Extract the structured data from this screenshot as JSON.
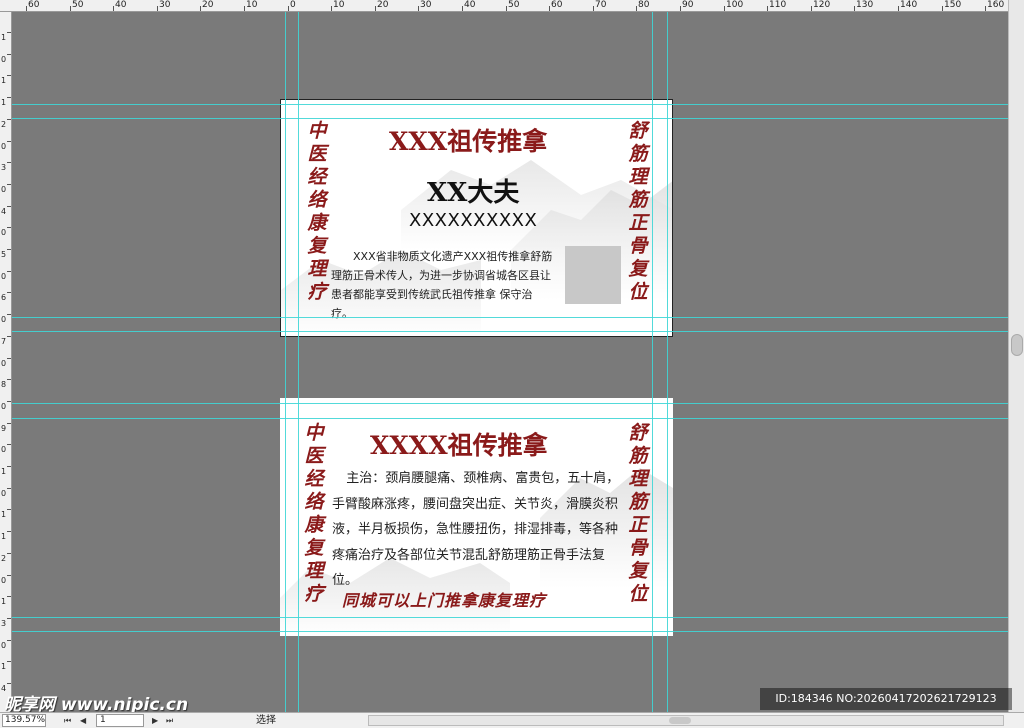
{
  "ruler": {
    "top_labels": [
      "60",
      "50",
      "40",
      "30",
      "20",
      "10",
      "0",
      "10",
      "20",
      "30",
      "40",
      "50",
      "60",
      "70",
      "80",
      "90",
      "100",
      "110",
      "120",
      "130",
      "140",
      "150",
      "160"
    ],
    "left_labels": [
      "1",
      "0",
      "1",
      "1",
      "2",
      "0",
      "3",
      "0",
      "4",
      "0",
      "5",
      "0",
      "6",
      "0",
      "7",
      "0",
      "8",
      "0",
      "9",
      "0",
      "1",
      "0",
      "1",
      "1",
      "2",
      "0",
      "1",
      "3",
      "0",
      "1",
      "4"
    ]
  },
  "card_front": {
    "title": "XXX祖传推拿",
    "doctor": "XX大夫",
    "phone": "XXXXXXXXXX",
    "left_vertical": "中医经络康复理疗",
    "right_vertical": "舒筋理筋正骨复位",
    "description": "XXX省非物质文化遗产XXX祖传推拿舒筋理筋正骨术传人，为进一步协调省城各区县让患者都能享受到传统武氏祖传推拿 保守治疗。"
  },
  "card_back": {
    "title": "XXXX祖传推拿",
    "left_vertical": "中医经络康复理疗",
    "right_vertical": "舒筋理筋正骨复位",
    "treatment": "主治：颈肩腰腿痛、颈椎病、富贵包，五十肩，手臂酸麻涨疼，腰间盘突出症、关节炎，滑膜炎积液，半月板损伤，急性腰扭伤，排湿排毒，等各种疼痛治疗及各部位关节混乱舒筋理筋正骨手法复位。",
    "slogan": "同城可以上门推拿康复理疗"
  },
  "statusbar": {
    "zoom": "139.57%",
    "page": "1",
    "status": "选择"
  },
  "watermark": {
    "logo": "昵享网 www.nipic.cn",
    "id_text": "ID:184346 NO:20260417202621729123"
  },
  "colors": {
    "accent": "#8a1a1a",
    "guide": "#3fd6d6",
    "canvas": "#7a7a7a"
  }
}
